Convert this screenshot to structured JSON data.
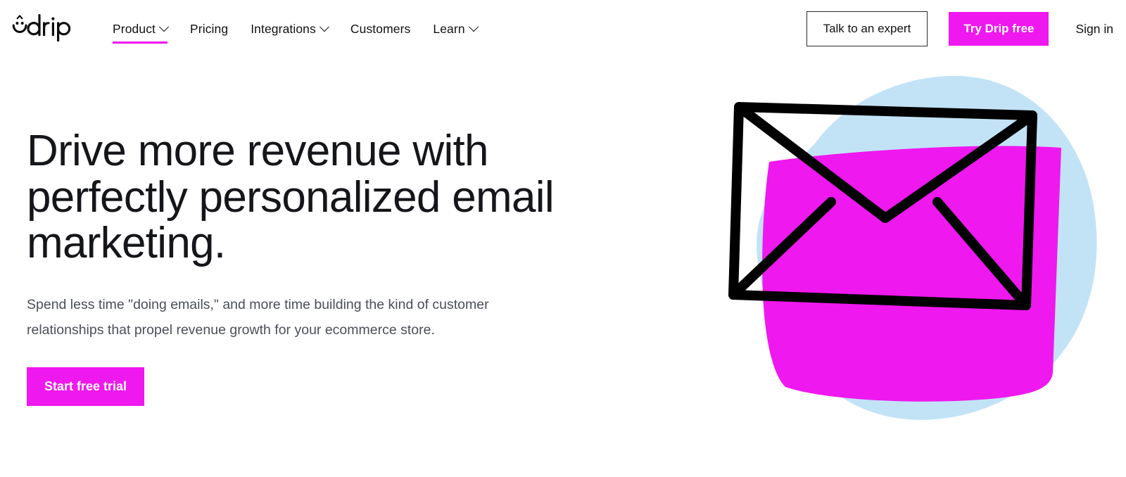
{
  "brand": {
    "name": "drip",
    "logo_icon": "drip-smiley-logo"
  },
  "nav": {
    "items": [
      {
        "label": "Product",
        "has_dropdown": true,
        "active": true
      },
      {
        "label": "Pricing",
        "has_dropdown": false,
        "active": false
      },
      {
        "label": "Integrations",
        "has_dropdown": true,
        "active": false
      },
      {
        "label": "Customers",
        "has_dropdown": false,
        "active": false
      },
      {
        "label": "Learn",
        "has_dropdown": true,
        "active": false
      }
    ]
  },
  "header_actions": {
    "talk_to_expert_label": "Talk to an expert",
    "try_free_label": "Try Drip free",
    "sign_in_label": "Sign in"
  },
  "hero": {
    "title": "Drive more revenue with perfectly personalized email marketing.",
    "subtitle": "Spend less time \"doing emails,\" and more time building the kind of customer relationships that propel revenue growth for your ecommerce store.",
    "cta_label": "Start free trial",
    "illustration": {
      "name": "envelope-illustration",
      "blob_icon": "blue-blob-shape",
      "card_icon": "magenta-card-shape",
      "envelope_icon": "envelope-outline-icon"
    }
  },
  "colors": {
    "magenta": "#ef18ef",
    "light_blue": "#c2e3f6",
    "ink": "#111111",
    "body_text": "#4a4f57",
    "outline_border": "#2b2b2b",
    "background": "#ffffff"
  }
}
